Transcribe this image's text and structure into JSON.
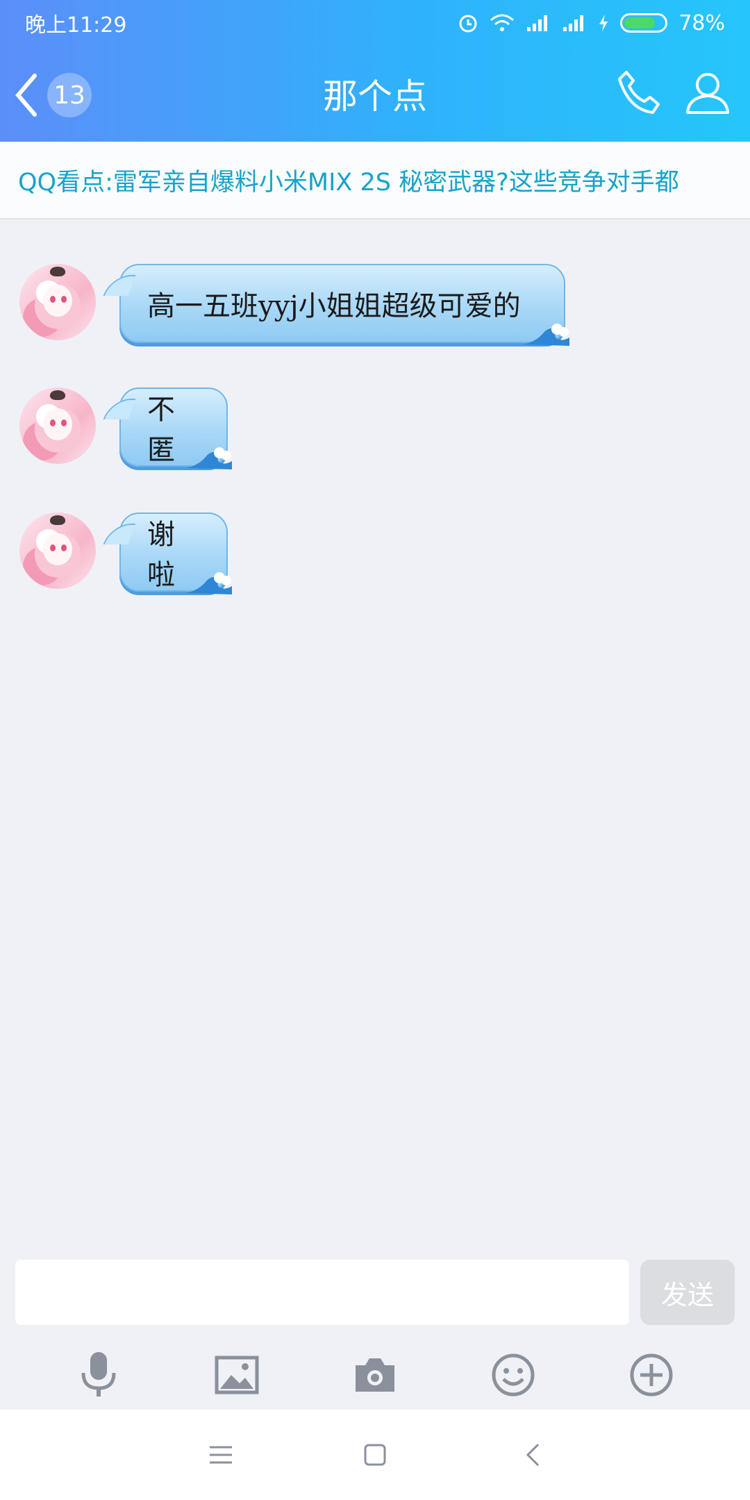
{
  "status_bar": {
    "time": "晚上11:29",
    "battery_percent": "78%",
    "battery_level": 0.78,
    "icons": [
      "alarm-icon",
      "wifi-icon",
      "signal-icon",
      "signal-icon",
      "charging-icon",
      "battery-icon"
    ]
  },
  "nav": {
    "back_count": "13",
    "title": "那个点",
    "icons": [
      "back-arrow-icon",
      "phone-icon",
      "profile-icon"
    ]
  },
  "news": {
    "text": "QQ看点:雷军亲自爆料小米MIX 2S 秘密武器?这些竞争对手都"
  },
  "messages": [
    {
      "text": "高一五班yyj小姐姐超级可爱的"
    },
    {
      "text": "不匿"
    },
    {
      "text": "谢啦"
    }
  ],
  "composer": {
    "input_value": "",
    "send_label": "发送",
    "tools": [
      "microphone-icon",
      "image-icon",
      "camera-icon",
      "emoji-icon",
      "plus-icon"
    ]
  },
  "system_nav": {
    "icons": [
      "menu-icon",
      "home-icon",
      "back-icon"
    ]
  },
  "colors": {
    "header_gradient_start": "#5c8ef9",
    "header_gradient_end": "#25c6fb",
    "news_text": "#17a3c9",
    "bubble": "#a9d8f7",
    "background": "#eff1f6"
  }
}
